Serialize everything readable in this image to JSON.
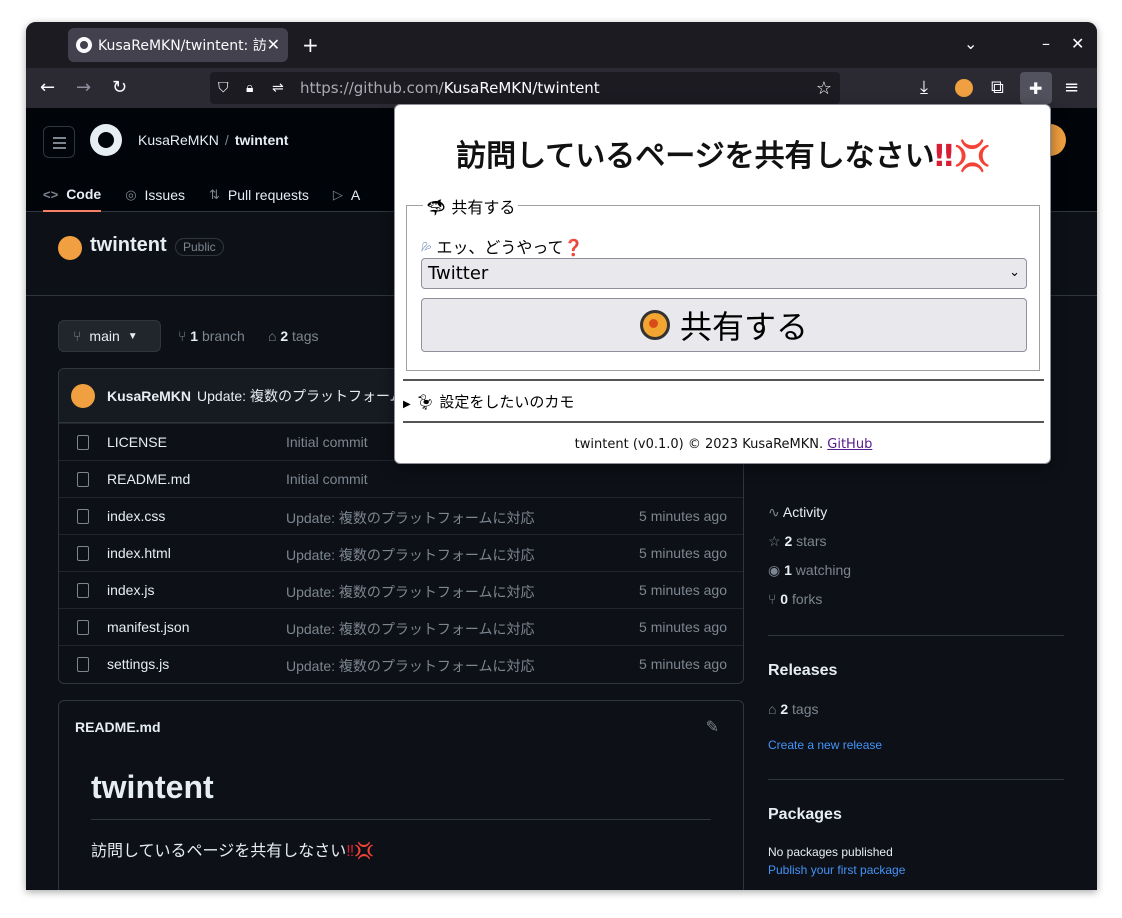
{
  "browser": {
    "tab_title": "KusaReMKN/twintent: 訪",
    "tab_close": "✕",
    "new_tab": "+",
    "url_host": "https://github.com/",
    "url_path": "KusaReMKN/twintent",
    "controls": {
      "dropdown": "⌄",
      "minimize": "–",
      "close": "✕"
    }
  },
  "github": {
    "owner": "KusaReMKN",
    "separator": "/",
    "repo": "twintent",
    "tabs": [
      {
        "label": "Code",
        "icon": "<>"
      },
      {
        "label": "Issues",
        "icon": "◎"
      },
      {
        "label": "Pull requests",
        "icon": "⇅"
      },
      {
        "label": "A",
        "icon": "▷"
      }
    ],
    "visibility": "Public",
    "branch": "main",
    "branch_count": "1",
    "branch_word": "branch",
    "tag_count": "2",
    "tag_word": "tags",
    "last_commit": {
      "author": "KusaReMKN",
      "message": "Update: 複数のプラットフォーム"
    },
    "files": [
      {
        "name": "LICENSE",
        "message": "Initial commit",
        "time": ""
      },
      {
        "name": "README.md",
        "message": "Initial commit",
        "time": ""
      },
      {
        "name": "index.css",
        "message": "Update: 複数のプラットフォームに対応",
        "time": "5 minutes ago"
      },
      {
        "name": "index.html",
        "message": "Update: 複数のプラットフォームに対応",
        "time": "5 minutes ago"
      },
      {
        "name": "index.js",
        "message": "Update: 複数のプラットフォームに対応",
        "time": "5 minutes ago"
      },
      {
        "name": "manifest.json",
        "message": "Update: 複数のプラットフォームに対応",
        "time": "5 minutes ago"
      },
      {
        "name": "settings.js",
        "message": "Update: 複数のプラットフォームに対応",
        "time": "5 minutes ago"
      }
    ],
    "readme": {
      "title": "README.md",
      "heading": "twintent",
      "body": "訪問しているページを共有しなさい",
      "body_emoji": "‼💢"
    },
    "sidebar": {
      "activity": "Activity",
      "stars_count": "2",
      "stars_word": "stars",
      "watching_count": "1",
      "watching_word": "watching",
      "forks_count": "0",
      "forks_word": "forks",
      "releases_heading": "Releases",
      "releases_tag_count": "2",
      "releases_tag_word": "tags",
      "create_release": "Create a new release",
      "packages_heading": "Packages",
      "no_packages": "No packages published",
      "publish_package": "Publish your first package"
    }
  },
  "popup": {
    "title": "訪問しているページを共有しなさい",
    "title_emoji": "‼💢",
    "legend": "共有する",
    "question": "エッ、どうやって",
    "question_mark": "❓",
    "platform_selected": "Twitter",
    "share_button": "共有する",
    "settings_summary": "設定をしたいのカモ",
    "footer_text": "twintent (v0.1.0) © 2023 KusaReMKN.",
    "footer_link": "GitHub"
  }
}
